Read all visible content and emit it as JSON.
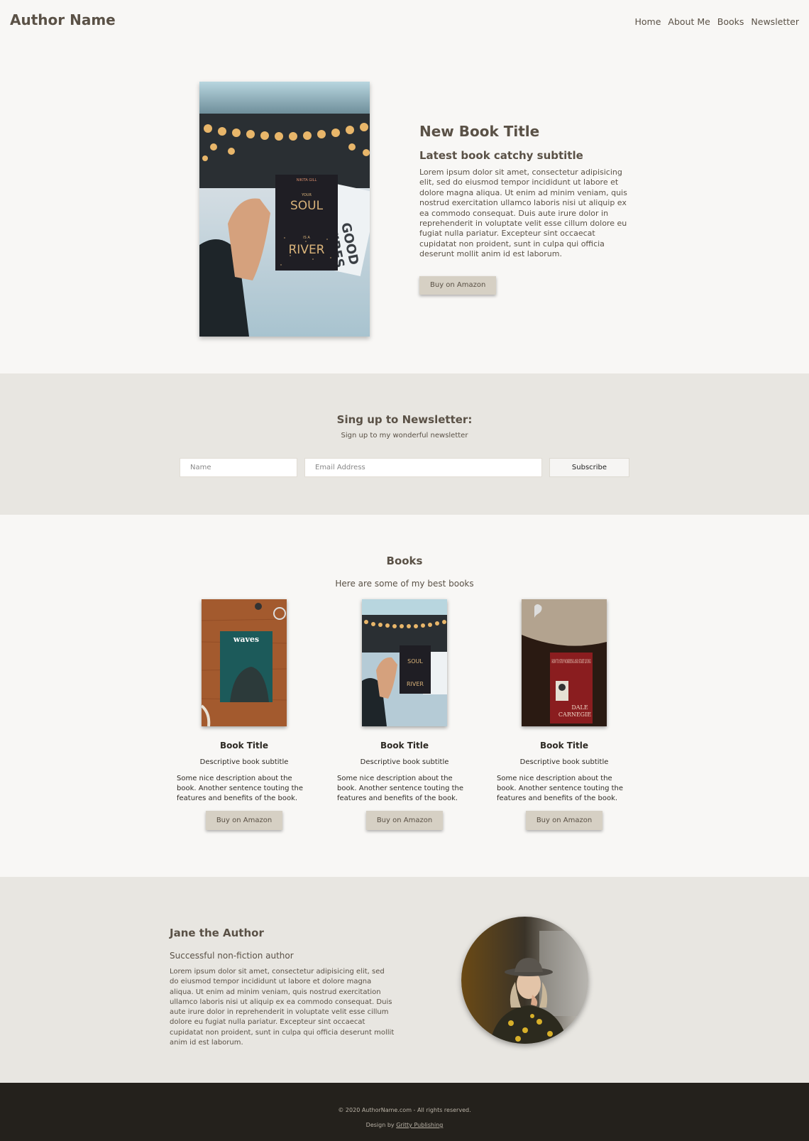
{
  "header": {
    "logo": "Author Name",
    "nav": [
      "Home",
      "About Me",
      "Books",
      "Newsletter"
    ]
  },
  "hero": {
    "title": "New Book Title",
    "subtitle": "Latest book catchy subtitle",
    "body": "Lorem ipsum dolor sit amet, consectetur adipisicing elit, sed do eiusmod tempor incididunt ut labore et dolore magna aliqua. Ut enim ad minim veniam, quis nostrud exercitation ullamco laboris nisi ut aliquip ex ea commodo consequat. Duis aute irure dolor in reprehenderit in voluptate velit esse cillum dolore eu fugiat nulla pariatur. Excepteur sint occaecat cupidatat non proident, sunt in culpa qui officia deserunt mollit anim id est laborum.",
    "button": "Buy on Amazon",
    "cover_text": {
      "author": "NIKITA GILL",
      "line1": "YOUR",
      "line2": "SOUL",
      "line3": "IS A",
      "line4": "RIVER"
    },
    "sign_text": [
      "GOOD",
      "VIBES"
    ]
  },
  "newsletter": {
    "title": "Sing up to Newsletter:",
    "subtitle": "Sign up to my wonderful newsletter",
    "name_placeholder": "Name",
    "email_placeholder": "Email Address",
    "button": "Subscribe"
  },
  "books": {
    "title": "Books",
    "subtitle": "Here are some of my best books",
    "items": [
      {
        "title": "Book Title",
        "subtitle": "Descriptive book subtitle",
        "description": "Some nice description about the book. Another sentence touting the features and benefits of the book.",
        "button": "Buy on Amazon",
        "cover_label": "waves"
      },
      {
        "title": "Book Title",
        "subtitle": "Descriptive book subtitle",
        "description": "Some nice description about the book. Another sentence touting the features and benefits of the book.",
        "button": "Buy on Amazon",
        "cover_label": "SOUL"
      },
      {
        "title": "Book Title",
        "subtitle": "Descriptive book subtitle",
        "description": "Some nice description about the book. Another sentence touting the features and benefits of the book.",
        "button": "Buy on Amazon",
        "cover_label": "HOW TO STOP WORRYING AND START LIVING"
      }
    ]
  },
  "about": {
    "name": "Jane the Author",
    "role": "Successful non-fiction author",
    "bio": "Lorem ipsum dolor sit amet, consectetur adipisicing elit, sed do eiusmod tempor incididunt ut labore et dolore magna aliqua. Ut enim ad minim veniam, quis nostrud exercitation ullamco laboris nisi ut aliquip ex ea commodo consequat. Duis aute irure dolor in reprehenderit in voluptate velit esse cillum dolore eu fugiat nulla pariatur. Excepteur sint occaecat cupidatat non proident, sunt in culpa qui officia deserunt mollit anim id est laborum."
  },
  "footer": {
    "copyright": "© 2020 AuthorName.com - All rights reserved.",
    "design_prefix": "Design by ",
    "design_link": "Gritty Publishing"
  },
  "colors": {
    "background": "#f8f7f5",
    "section_alt": "#e8e6e1",
    "text": "#5a5146",
    "button": "#d6d0c4",
    "footer": "#24211c"
  }
}
